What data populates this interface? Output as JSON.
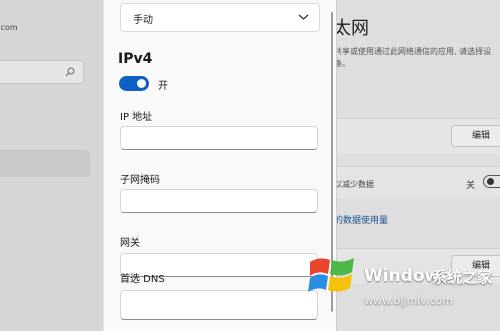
{
  "background": {
    "account_email": ".com",
    "section_title": "太网",
    "description": "共享或使用通过此网络通信的应用, 请选择设备。",
    "edit_label": "编辑",
    "metered_label": "以减少数据",
    "metered_state": "关",
    "data_usage_link": "的数据使用量"
  },
  "panel": {
    "mode_dropdown": {
      "value": "手动"
    },
    "ipv4_title": "IPv4",
    "ipv4_toggle": {
      "state_label": "开",
      "on": true,
      "accent": "#0f62c4"
    },
    "fields": [
      {
        "label": "IP 地址",
        "value": ""
      },
      {
        "label": "子网掩码",
        "value": ""
      },
      {
        "label": "网关",
        "value": ""
      },
      {
        "label": "首选 DNS",
        "value": ""
      }
    ]
  },
  "watermark": {
    "brand": "Windows",
    "sub": "系统之家",
    "url": "www.bjjmlv.com"
  }
}
